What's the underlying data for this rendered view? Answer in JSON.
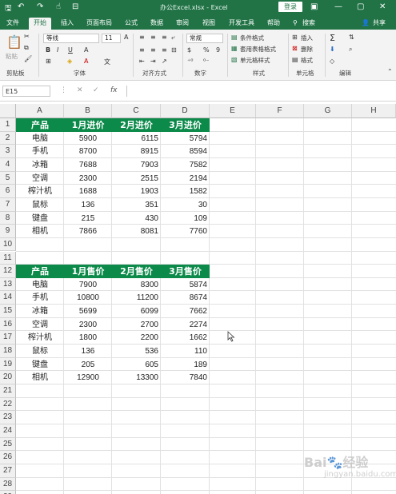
{
  "window": {
    "title": "办公Excel.xlsx - Excel",
    "login_label": "登录",
    "minimize": "—",
    "restore": "▢",
    "close": "✕"
  },
  "tabs": [
    {
      "label": "文件"
    },
    {
      "label": "开始",
      "active": true
    },
    {
      "label": "插入"
    },
    {
      "label": "页面布局"
    },
    {
      "label": "公式"
    },
    {
      "label": "数据"
    },
    {
      "label": "审阅"
    },
    {
      "label": "视图"
    },
    {
      "label": "开发工具"
    },
    {
      "label": "帮助"
    },
    {
      "label": "搜索"
    },
    {
      "label": "共享"
    }
  ],
  "ribbon": {
    "paste_label": "粘贴",
    "font_name": "等线",
    "font_size": "11",
    "number_format": "常规",
    "conditional_format": "条件格式",
    "table_format": "套用表格格式",
    "cell_style": "单元格样式",
    "insert": "插入",
    "delete": "删除",
    "format": "格式",
    "groups": {
      "clipboard": "剪贴板",
      "font": "字体",
      "alignment": "对齐方式",
      "number": "数字",
      "styles": "样式",
      "cells": "单元格",
      "editing": "编辑"
    },
    "bold": "B",
    "italic": "I",
    "underline": "U",
    "percent": "%",
    "comma": "9"
  },
  "formula_bar": {
    "name_box": "E15",
    "fx": "fx",
    "value": ""
  },
  "columns": [
    "A",
    "B",
    "C",
    "D",
    "E",
    "F",
    "G",
    "H"
  ],
  "rows": [
    "1",
    "2",
    "3",
    "4",
    "5",
    "6",
    "7",
    "8",
    "9",
    "10",
    "11",
    "12",
    "13",
    "14",
    "15",
    "16",
    "17",
    "18",
    "19",
    "20",
    "21",
    "22",
    "23",
    "24",
    "25",
    "26",
    "27",
    "28",
    "29"
  ],
  "table1": {
    "headers": [
      "产品",
      "1月进价",
      "2月进价",
      "3月进价"
    ],
    "rows": [
      [
        "电脑",
        "5900",
        "6115",
        "5794"
      ],
      [
        "手机",
        "8700",
        "8915",
        "8594"
      ],
      [
        "冰箱",
        "7688",
        "7903",
        "7582"
      ],
      [
        "空调",
        "2300",
        "2515",
        "2194"
      ],
      [
        "榨汁机",
        "1688",
        "1903",
        "1582"
      ],
      [
        "鼠标",
        "136",
        "351",
        "30"
      ],
      [
        "键盘",
        "215",
        "430",
        "109"
      ],
      [
        "相机",
        "7866",
        "8081",
        "7760"
      ]
    ]
  },
  "table2": {
    "headers": [
      "产品",
      "1月售价",
      "2月售价",
      "3月售价"
    ],
    "rows": [
      [
        "电脑",
        "7900",
        "8300",
        "5874"
      ],
      [
        "手机",
        "10800",
        "11200",
        "8674"
      ],
      [
        "冰箱",
        "5699",
        "6099",
        "7662"
      ],
      [
        "空调",
        "2300",
        "2700",
        "2274"
      ],
      [
        "榨汁机",
        "1800",
        "2200",
        "1662"
      ],
      [
        "鼠标",
        "136",
        "536",
        "110"
      ],
      [
        "键盘",
        "205",
        "605",
        "189"
      ],
      [
        "相机",
        "12900",
        "13300",
        "7840"
      ]
    ]
  },
  "watermark": {
    "logo": "Bai 经验",
    "url": "jingyan.baidu.com"
  },
  "colors": {
    "excel_green": "#217346",
    "header_fill": "#0c8a4a"
  }
}
